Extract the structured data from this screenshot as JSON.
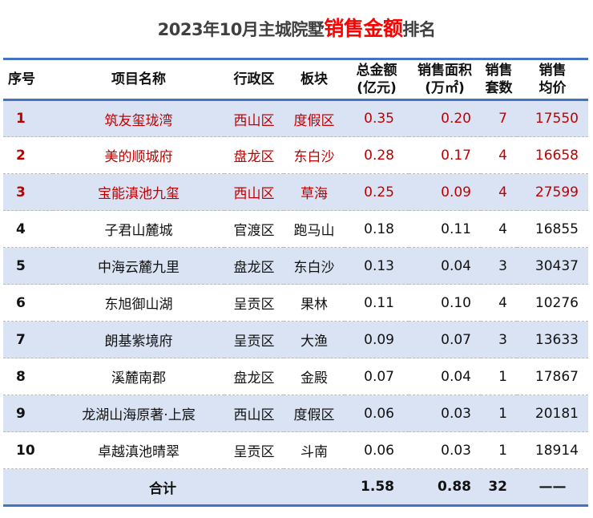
{
  "title": {
    "prefix": "2023年10月主城院墅",
    "highlight": "销售金额",
    "suffix": "排名"
  },
  "headers": {
    "no": "序号",
    "name": "项目名称",
    "district": "行政区",
    "area": "板块",
    "amount": "总金额\n(亿元)",
    "sqm": "销售面积\n(万㎡)",
    "units": "销售\n套数",
    "price": "销售\n均价"
  },
  "rows": [
    {
      "no": "1",
      "name": "筑友玺珑湾",
      "district": "西山区",
      "area": "度假区",
      "amount": "0.35",
      "sqm": "0.20",
      "units": "7",
      "price": "17550"
    },
    {
      "no": "2",
      "name": "美的顺城府",
      "district": "盘龙区",
      "area": "东白沙",
      "amount": "0.28",
      "sqm": "0.17",
      "units": "4",
      "price": "16658"
    },
    {
      "no": "3",
      "name": "宝能滇池九玺",
      "district": "西山区",
      "area": "草海",
      "amount": "0.25",
      "sqm": "0.09",
      "units": "4",
      "price": "27599"
    },
    {
      "no": "4",
      "name": "子君山麓城",
      "district": "官渡区",
      "area": "跑马山",
      "amount": "0.18",
      "sqm": "0.11",
      "units": "4",
      "price": "16855"
    },
    {
      "no": "5",
      "name": "中海云麓九里",
      "district": "盘龙区",
      "area": "东白沙",
      "amount": "0.13",
      "sqm": "0.04",
      "units": "3",
      "price": "30437"
    },
    {
      "no": "6",
      "name": "东旭御山湖",
      "district": "呈贡区",
      "area": "果林",
      "amount": "0.11",
      "sqm": "0.10",
      "units": "4",
      "price": "10276"
    },
    {
      "no": "7",
      "name": "朗基紫境府",
      "district": "呈贡区",
      "area": "大渔",
      "amount": "0.09",
      "sqm": "0.07",
      "units": "3",
      "price": "13633"
    },
    {
      "no": "8",
      "name": "溪麓南郡",
      "district": "盘龙区",
      "area": "金殿",
      "amount": "0.07",
      "sqm": "0.04",
      "units": "1",
      "price": "17867"
    },
    {
      "no": "9",
      "name": "龙湖山海原著·上宸",
      "district": "西山区",
      "area": "度假区",
      "amount": "0.06",
      "sqm": "0.03",
      "units": "1",
      "price": "20181"
    },
    {
      "no": "10",
      "name": "卓越滇池晴翠",
      "district": "呈贡区",
      "area": "斗南",
      "amount": "0.06",
      "sqm": "0.03",
      "units": "1",
      "price": "18914"
    }
  ],
  "total": {
    "label": "合计",
    "amount": "1.58",
    "sqm": "0.88",
    "units": "32",
    "price": "——"
  }
}
